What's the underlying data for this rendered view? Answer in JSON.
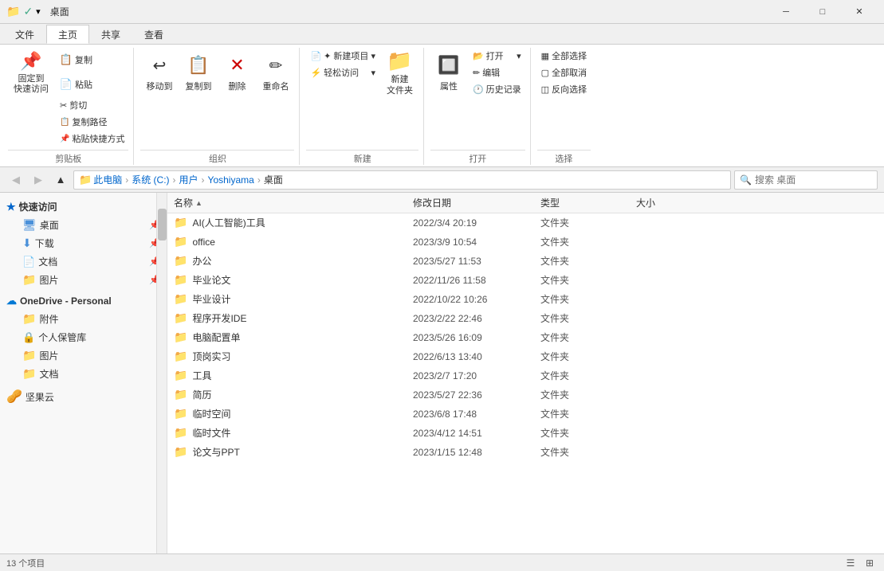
{
  "titleBar": {
    "title": "桌面",
    "icons": [
      "folder-icon",
      "check-icon",
      "down-arrow-icon"
    ]
  },
  "ribbonTabs": [
    {
      "id": "file",
      "label": "文件",
      "active": false
    },
    {
      "id": "home",
      "label": "主页",
      "active": true
    },
    {
      "id": "share",
      "label": "共享",
      "active": false
    },
    {
      "id": "view",
      "label": "查看",
      "active": false
    }
  ],
  "ribbonGroups": [
    {
      "id": "clipboard",
      "label": "剪贴板",
      "items": [
        {
          "id": "pin",
          "label": "固定到\n快速访问",
          "type": "large",
          "icon": "📌"
        },
        {
          "id": "copy",
          "label": "复制",
          "type": "large",
          "icon": "📋"
        },
        {
          "id": "paste",
          "label": "粘贴",
          "type": "large",
          "icon": "📄"
        },
        {
          "id": "cut",
          "label": "剪切",
          "type": "small",
          "icon": "✂"
        },
        {
          "id": "copy-path",
          "label": "复制路径",
          "type": "small",
          "icon": ""
        },
        {
          "id": "paste-shortcut",
          "label": "粘贴快捷方式",
          "type": "small",
          "icon": ""
        }
      ]
    },
    {
      "id": "organize",
      "label": "组织",
      "items": [
        {
          "id": "move-to",
          "label": "移动到",
          "type": "large",
          "icon": "↩"
        },
        {
          "id": "copy-to",
          "label": "复制到",
          "type": "large",
          "icon": "📋"
        },
        {
          "id": "delete",
          "label": "删除",
          "type": "large",
          "icon": "✕"
        },
        {
          "id": "rename",
          "label": "重命名",
          "type": "large",
          "icon": "✏"
        }
      ]
    },
    {
      "id": "new",
      "label": "新建",
      "items": [
        {
          "id": "new-item",
          "label": "新建项目",
          "type": "small",
          "icon": ""
        },
        {
          "id": "easy-access",
          "label": "轻松访问",
          "type": "small",
          "icon": ""
        },
        {
          "id": "new-folder",
          "label": "新建\n文件夹",
          "type": "large",
          "icon": "📁"
        }
      ]
    },
    {
      "id": "open",
      "label": "打开",
      "items": [
        {
          "id": "properties",
          "label": "属性",
          "type": "large",
          "icon": "🔲"
        },
        {
          "id": "open-btn",
          "label": "打开",
          "type": "small",
          "icon": ""
        },
        {
          "id": "edit",
          "label": "编辑",
          "type": "small",
          "icon": ""
        },
        {
          "id": "history",
          "label": "历史记录",
          "type": "small",
          "icon": ""
        }
      ]
    },
    {
      "id": "select",
      "label": "选择",
      "items": [
        {
          "id": "select-all",
          "label": "全部选择",
          "type": "small",
          "icon": ""
        },
        {
          "id": "select-none",
          "label": "全部取消",
          "type": "small",
          "icon": ""
        },
        {
          "id": "invert-select",
          "label": "反向选择",
          "type": "small",
          "icon": ""
        }
      ]
    }
  ],
  "addressBar": {
    "breadcrumbs": [
      "此电脑",
      "系统 (C:)",
      "用户",
      "Yoshiyama",
      "桌面"
    ],
    "searchPlaceholder": "搜索 桌面"
  },
  "sidebar": {
    "sections": [
      {
        "id": "quick-access",
        "header": "★ 快速访问",
        "items": [
          {
            "id": "desktop",
            "label": "桌面",
            "icon": "folder-blue",
            "pinned": true
          },
          {
            "id": "downloads",
            "label": "下载",
            "icon": "download",
            "pinned": true
          },
          {
            "id": "documents",
            "label": "文档",
            "icon": "doc",
            "pinned": true
          },
          {
            "id": "pictures",
            "label": "图片",
            "icon": "folder",
            "pinned": true
          }
        ]
      },
      {
        "id": "onedrive",
        "header": "OneDrive - Personal",
        "items": [
          {
            "id": "attachments",
            "label": "附件",
            "icon": "folder"
          },
          {
            "id": "personal-vault",
            "label": "个人保管库",
            "icon": "doc"
          },
          {
            "id": "pictures2",
            "label": "图片",
            "icon": "folder"
          },
          {
            "id": "documents2",
            "label": "文档",
            "icon": "folder"
          }
        ]
      },
      {
        "id": "jiguoyun",
        "items": [
          {
            "id": "jiguoyun",
            "label": "坚果云",
            "icon": "walnut"
          }
        ]
      }
    ]
  },
  "fileList": {
    "columns": [
      {
        "id": "name",
        "label": "名称",
        "sortable": true
      },
      {
        "id": "date",
        "label": "修改日期",
        "sortable": true
      },
      {
        "id": "type",
        "label": "类型",
        "sortable": true
      },
      {
        "id": "size",
        "label": "大小",
        "sortable": true
      }
    ],
    "files": [
      {
        "name": "AI(人工智能)工具",
        "date": "2022/3/4 20:19",
        "type": "文件夹",
        "size": ""
      },
      {
        "name": "office",
        "date": "2023/3/9 10:54",
        "type": "文件夹",
        "size": ""
      },
      {
        "name": "办公",
        "date": "2023/5/27 11:53",
        "type": "文件夹",
        "size": ""
      },
      {
        "name": "毕业论文",
        "date": "2022/11/26 11:58",
        "type": "文件夹",
        "size": ""
      },
      {
        "name": "毕业设计",
        "date": "2022/10/22 10:26",
        "type": "文件夹",
        "size": ""
      },
      {
        "name": "程序开发IDE",
        "date": "2023/2/22 22:46",
        "type": "文件夹",
        "size": ""
      },
      {
        "name": "电脑配置单",
        "date": "2023/5/26 16:09",
        "type": "文件夹",
        "size": ""
      },
      {
        "name": "顶岗实习",
        "date": "2022/6/13 13:40",
        "type": "文件夹",
        "size": ""
      },
      {
        "name": "工具",
        "date": "2023/2/7 17:20",
        "type": "文件夹",
        "size": ""
      },
      {
        "name": "简历",
        "date": "2023/5/27 22:36",
        "type": "文件夹",
        "size": ""
      },
      {
        "name": "临时空间",
        "date": "2023/6/8 17:48",
        "type": "文件夹",
        "size": ""
      },
      {
        "name": "临时文件",
        "date": "2023/4/12 14:51",
        "type": "文件夹",
        "size": ""
      },
      {
        "name": "论文与PPT",
        "date": "2023/1/15 12:48",
        "type": "文件夹",
        "size": ""
      }
    ]
  },
  "statusBar": {
    "itemCount": "13 个项目",
    "viewModes": [
      "list",
      "details"
    ]
  }
}
